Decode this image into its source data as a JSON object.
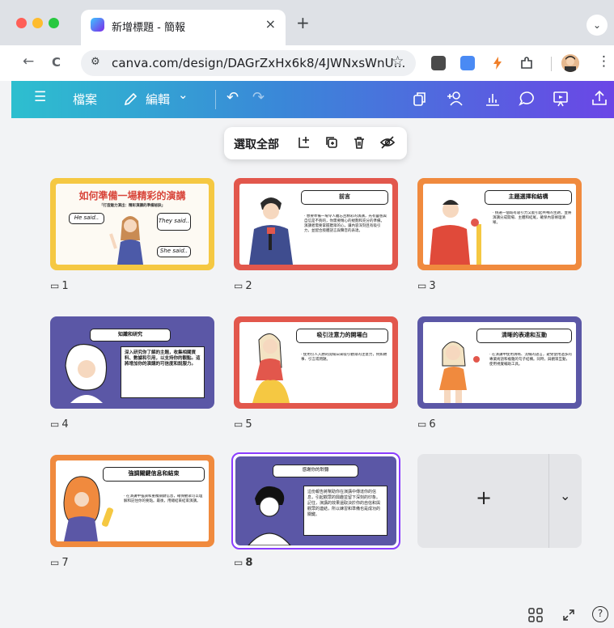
{
  "browser": {
    "tab_title": "新增標題 - 簡報",
    "tab_close": "×",
    "new_tab": "+",
    "tab_menu": "⌄",
    "url": "canva.com/design/DAGrZxHx6k8/4JWNxsWnU...",
    "back": "←",
    "reload": "C",
    "bookmark": "☆",
    "menu": "⋮",
    "colors": {
      "close": "#ff5f57",
      "minimize": "#febc2e",
      "zoom": "#28c840"
    }
  },
  "toolbar": {
    "menu": "☰",
    "file": "檔案",
    "edit": "編輯",
    "edit_chevron": "⌄",
    "undo": "↶",
    "redo": "↷"
  },
  "selection_bar": {
    "select_all": "選取全部"
  },
  "slides": [
    {
      "number": "1",
      "title": "如何準備一場精彩的演講",
      "subtitle": "「打造魅力演出：精彩演講的準備秘訣」",
      "bubbles": [
        "He said..",
        "They said..",
        "She said.."
      ],
      "border": "#f5c842"
    },
    {
      "number": "2",
      "title": "前言",
      "body": "‧ 想要準備一場令人難忘且精彩的演講，光有靈感與自信是不夠的，你需要精心的規劃和充分的準備。演講者需要掌握聽眾的心，讓內容深刻且有吸引力，並配合肢體語言與聲音的表達。",
      "border": "#e2574c"
    },
    {
      "number": "3",
      "title": "主題選擇和結構",
      "body": "‧ 挑選一個既有吸引力又能引起共鳴的主題，並將演講分成開場、主體和結尾，確保內容條理清晰。",
      "border": "#f08a3e"
    },
    {
      "number": "4",
      "title": "知識和研究",
      "body": "深入研究你了解的主題，收集相關資料、數據和引用，以支持你的觀點。這將增加你的演講的可信度和說服力。",
      "border": "#5b57a6"
    },
    {
      "number": "5",
      "title": "吸引注意力的開場白",
      "body": "‧ 使用引人入勝的開場白來吸引觀眾的注意力，例如故事、引言或問題。",
      "border": "#e2574c"
    },
    {
      "number": "6",
      "title": "清晰的表達和互動",
      "body": "‧ 在演講中使用清晰、流暢的語言，避免使用過多的專業術語和複雜的句子結構。同時，與觀眾互動，使用視覺輔助工具。",
      "border": "#5b57a6"
    },
    {
      "number": "7",
      "title": "強調關鍵信息和結束",
      "body": "‧ 在演講中強調和重複關鍵信息，確保觀眾可以理解和記住你的要點。最後，用總結來結束演講。",
      "border": "#f08a3e"
    },
    {
      "number": "8",
      "title": "感謝你的聆聽",
      "body": "這份報告將幫助你在演講中傳達你的信息，引起觀眾的興趣並留下深刻的印象。記住，演講的效果還取決於你的自信和與觀眾的連結，所以練習和準備也是成功的關鍵。",
      "border": "#5b57a6"
    }
  ],
  "add_tile": {
    "plus": "+",
    "chevron": "⌄"
  },
  "bottom": {
    "help": "?"
  }
}
